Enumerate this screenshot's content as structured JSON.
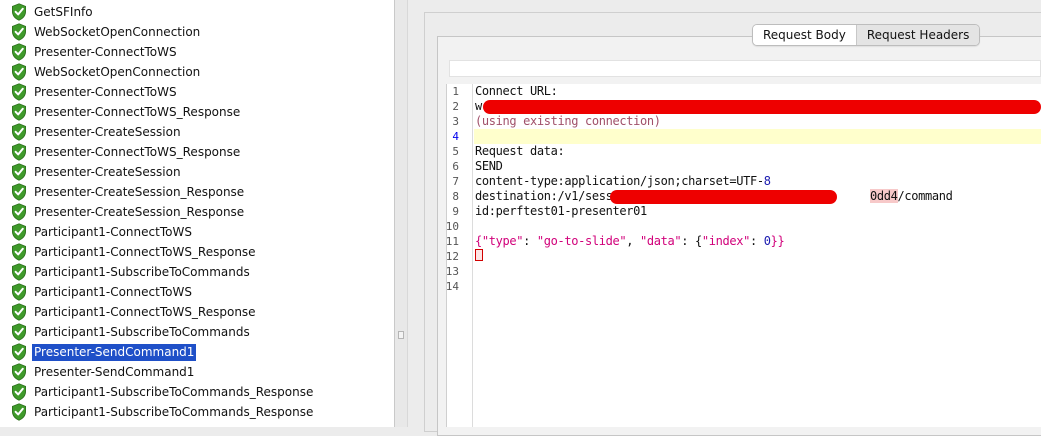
{
  "tree": {
    "items": [
      {
        "label": "GetSFInfo"
      },
      {
        "label": "WebSocketOpenConnection"
      },
      {
        "label": "Presenter-ConnectToWS"
      },
      {
        "label": "WebSocketOpenConnection"
      },
      {
        "label": "Presenter-ConnectToWS"
      },
      {
        "label": "Presenter-ConnectToWS_Response"
      },
      {
        "label": "Presenter-CreateSession"
      },
      {
        "label": "Presenter-ConnectToWS_Response"
      },
      {
        "label": "Presenter-CreateSession"
      },
      {
        "label": "Presenter-CreateSession_Response"
      },
      {
        "label": "Presenter-CreateSession_Response"
      },
      {
        "label": "Participant1-ConnectToWS"
      },
      {
        "label": "Participant1-ConnectToWS_Response"
      },
      {
        "label": "Participant1-SubscribeToCommands"
      },
      {
        "label": "Participant1-ConnectToWS"
      },
      {
        "label": "Participant1-ConnectToWS_Response"
      },
      {
        "label": "Participant1-SubscribeToCommands"
      },
      {
        "label": "Presenter-SendCommand1",
        "selected": true
      },
      {
        "label": "Presenter-SendCommand1"
      },
      {
        "label": "Participant1-SubscribeToCommands_Response"
      },
      {
        "label": "Participant1-SubscribeToCommands_Response"
      }
    ],
    "status_icon": "green-check-shield-icon",
    "status_color": "#3f9a2a",
    "selection_color": "#1f50c8"
  },
  "tabs": [
    {
      "label": "Request Body",
      "active": true
    },
    {
      "label": "Request Headers",
      "active": false
    }
  ],
  "editor": {
    "line_numbers": [
      "1",
      "2",
      "3",
      "4",
      "5",
      "6",
      "7",
      "8",
      "9",
      "10",
      "11",
      "12",
      "13",
      "14"
    ],
    "current_line": "4",
    "lines": {
      "l1": "Connect URL:",
      "l2_prefix": "w",
      "l3": "(using existing connection)",
      "l5": "Request data:",
      "l6": "SEND",
      "l7a": "content-type:application/json;charset=UTF-",
      "l7b": "8",
      "l8a": "destination:/v1/session/",
      "l8b": "0dd4",
      "l8c": "/command",
      "l9": "id:perftest01-presenter01",
      "l11_open": "{",
      "l11_k1": "\"type\"",
      "l11_c1": ": ",
      "l11_v1": "\"go-to-slide\"",
      "l11_c2": ", ",
      "l11_k2": "\"data\"",
      "l11_c3": ": {",
      "l11_k3": "\"index\"",
      "l11_c4": ": ",
      "l11_v2": "0",
      "l11_close": "}}"
    },
    "highlight_color": "#ffffcc",
    "redaction_color": "#ee0000"
  }
}
